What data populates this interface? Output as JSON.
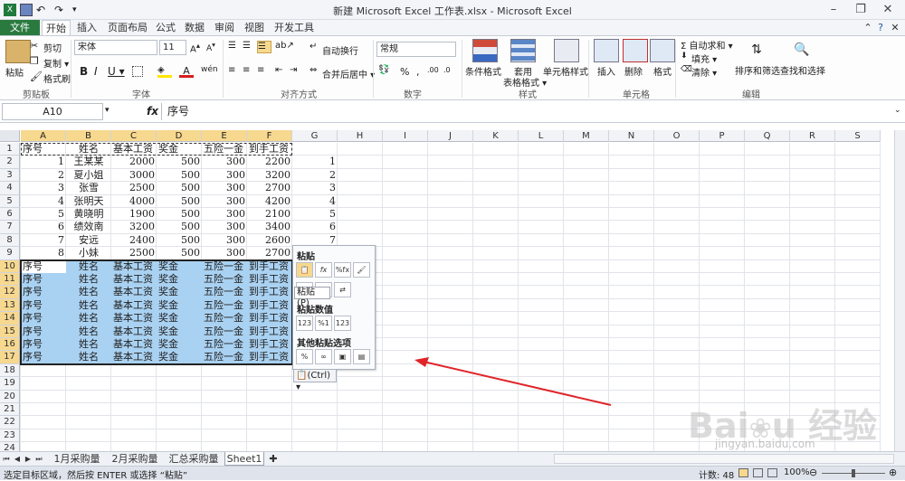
{
  "window": {
    "title": "新建 Microsoft Excel 工作表.xlsx - Microsoft Excel"
  },
  "ribbon_tabs": [
    "文件",
    "开始",
    "插入",
    "页面布局",
    "公式",
    "数据",
    "审阅",
    "视图",
    "开发工具"
  ],
  "ribbon": {
    "clipboard": {
      "paste": "粘贴",
      "cut": "剪切",
      "copy": "复制 ▾",
      "format_painter": "格式刷",
      "label": "剪贴板"
    },
    "font": {
      "name": "宋体",
      "size": "11",
      "bold": "B",
      "italic": "I",
      "underline": "U ▾",
      "label": "字体"
    },
    "alignment": {
      "wrap": "自动换行",
      "merge": "合并后居中 ▾",
      "label": "对齐方式"
    },
    "number": {
      "format": "常规",
      "percent": "%",
      "comma": ",",
      "label": "数字"
    },
    "styles": {
      "cond": "条件格式",
      "table_l1": "套用",
      "table_l2": "表格格式 ▾",
      "cell": "单元格样式",
      "label": "样式"
    },
    "cells": {
      "insert": "插入",
      "delete": "删除",
      "format": "格式",
      "label": "单元格"
    },
    "editing": {
      "autosum": "Σ 自动求和 ▾",
      "fill": "填充 ▾",
      "clear": "清除 ▾",
      "sort": "排序和筛选",
      "find": "查找和选择",
      "label": "编辑"
    }
  },
  "formula_bar": {
    "name_box": "A10",
    "fx": "fx",
    "content": "序号"
  },
  "columns": [
    "A",
    "B",
    "C",
    "D",
    "E",
    "F",
    "G",
    "H",
    "I",
    "J",
    "K",
    "L",
    "M",
    "N",
    "O",
    "P",
    "Q",
    "R",
    "S"
  ],
  "header_row": [
    "序号",
    "姓名",
    "基本工资",
    "奖金",
    "五险一金",
    "到手工资"
  ],
  "data_rows": [
    {
      "a": "1",
      "b": "王某某",
      "c": "2000",
      "d": "500",
      "e": "300",
      "f": "2200",
      "g": "1"
    },
    {
      "a": "2",
      "b": "夏小姐",
      "c": "3000",
      "d": "500",
      "e": "300",
      "f": "3200",
      "g": "2"
    },
    {
      "a": "3",
      "b": "张雪",
      "c": "2500",
      "d": "500",
      "e": "300",
      "f": "2700",
      "g": "3"
    },
    {
      "a": "4",
      "b": "张明天",
      "c": "4000",
      "d": "500",
      "e": "300",
      "f": "4200",
      "g": "4"
    },
    {
      "a": "5",
      "b": "黄晓明",
      "c": "1900",
      "d": "500",
      "e": "300",
      "f": "2100",
      "g": "5"
    },
    {
      "a": "6",
      "b": "绩效南",
      "c": "3200",
      "d": "500",
      "e": "300",
      "f": "3400",
      "g": "6"
    },
    {
      "a": "7",
      "b": "安远",
      "c": "2400",
      "d": "500",
      "e": "300",
      "f": "2600",
      "g": "7"
    },
    {
      "a": "8",
      "b": "小妹",
      "c": "2500",
      "d": "500",
      "e": "300",
      "f": "2700",
      "g": ""
    }
  ],
  "pasted_rows": [
    10,
    11,
    12,
    13,
    14,
    15,
    16,
    17
  ],
  "row_numbers": [
    "1",
    "2",
    "3",
    "4",
    "5",
    "6",
    "7",
    "8",
    "9",
    "10",
    "11",
    "12",
    "13",
    "14",
    "15",
    "16",
    "17",
    "18",
    "19",
    "20",
    "21",
    "22",
    "23",
    "24"
  ],
  "paste_menu": {
    "paste": "粘贴",
    "paste_values": "粘贴数值",
    "other": "其他粘贴选项",
    "tooltip": "粘贴 (P)",
    "ctrl": "(Ctrl) ▾",
    "icons": [
      "paste-icon",
      "formula-icon",
      "formula-format-icon",
      "keep-source-icon",
      "no-border-icon",
      "keep-width-icon",
      "transpose-icon",
      "values-icon",
      "values-numformat-icon",
      "values-source-icon",
      "formatting-icon",
      "link-icon",
      "picture-icon",
      "linked-picture-icon"
    ]
  },
  "sheet_tabs": [
    "1月采购量",
    "2月采购量",
    "汇总采购量",
    "Sheet1"
  ],
  "status": {
    "message": "选定目标区域，然后按 ENTER 或选择 “粘贴”",
    "count": "计数: 48",
    "zoom": "100%"
  },
  "colors": {
    "selection": "#a9d1f1",
    "header_sel": "#f7d88f",
    "file_tab": "#2a7a3f",
    "arrow": "#e0242a"
  }
}
